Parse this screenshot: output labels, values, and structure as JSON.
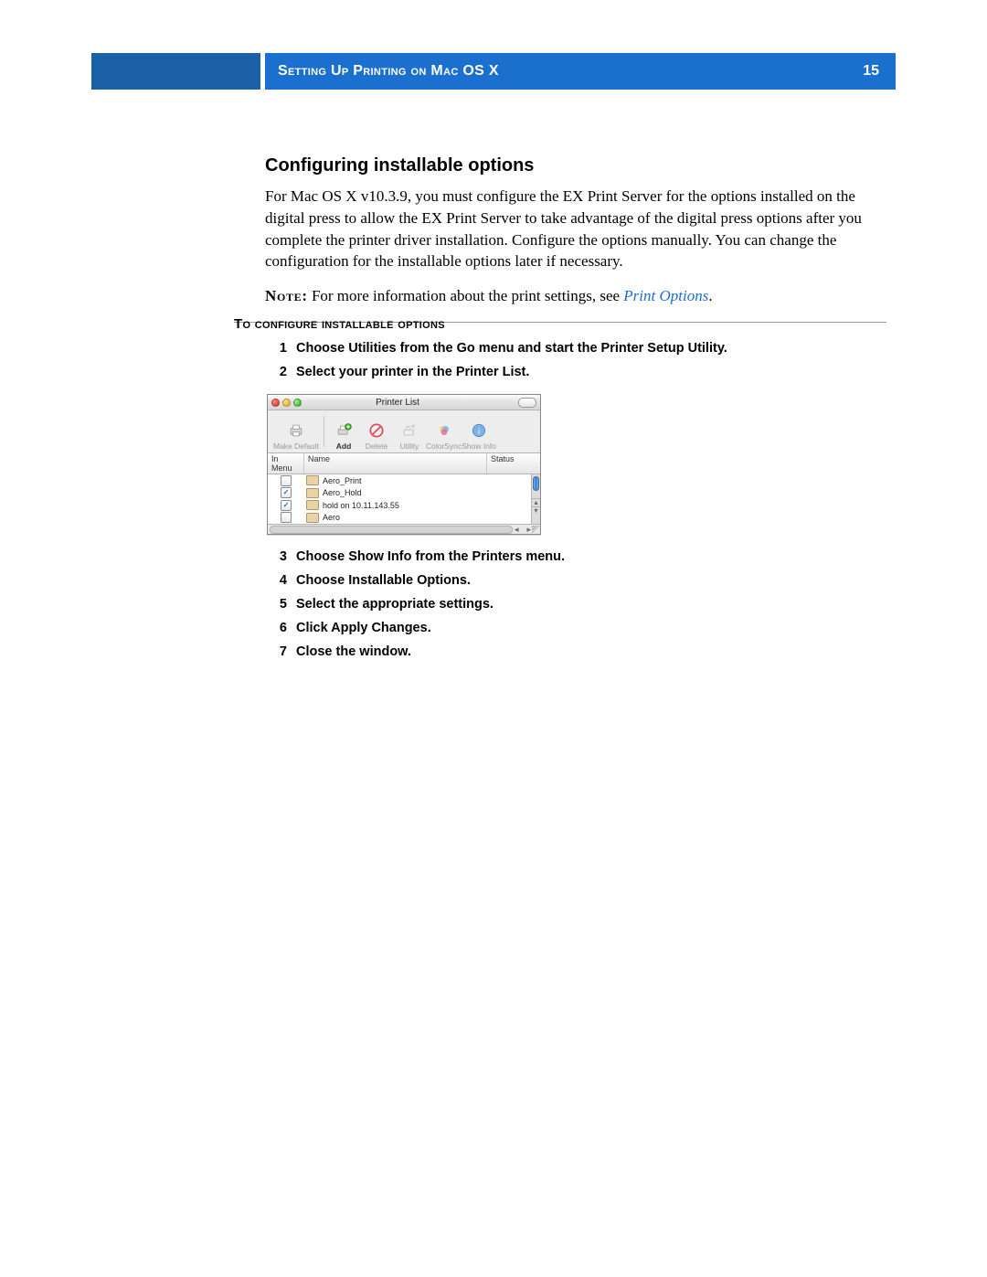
{
  "header": {
    "title": "Setting Up Printing on Mac OS X",
    "page_number": "15"
  },
  "section": {
    "heading": "Configuring installable options",
    "body": "For Mac OS X v10.3.9, you must configure the EX Print Server for the options installed on the digital press to allow the EX Print Server to take advantage of the digital press options after you complete the printer driver installation. Configure the options manually. You can change the configuration for the installable options later if necessary.",
    "note_label": "Note:",
    "note_body": " For more information about the print settings, see ",
    "note_link": "Print Options",
    "note_tail": "."
  },
  "procedure": {
    "title": "To configure installable options",
    "steps": [
      "Choose Utilities from the Go menu and start the Printer Setup Utility.",
      "Select your printer in the Printer List.",
      "Choose Show Info from the Printers menu.",
      "Choose Installable Options.",
      "Select the appropriate settings.",
      "Click Apply Changes.",
      "Close the window."
    ]
  },
  "mock": {
    "window_title": "Printer List",
    "toolbar": {
      "make_default": "Make Default",
      "add": "Add",
      "delete": "Delete",
      "utility": "Utility",
      "colorsync": "ColorSync",
      "show_info": "Show Info"
    },
    "columns": {
      "in_menu": "In Menu",
      "name": "Name",
      "status": "Status"
    },
    "rows": [
      {
        "checked": false,
        "name": "Aero_Print"
      },
      {
        "checked": true,
        "name": "Aero_Hold"
      },
      {
        "checked": true,
        "name": "hold on 10.11.143.55"
      },
      {
        "checked": false,
        "name": "Aero"
      }
    ]
  }
}
